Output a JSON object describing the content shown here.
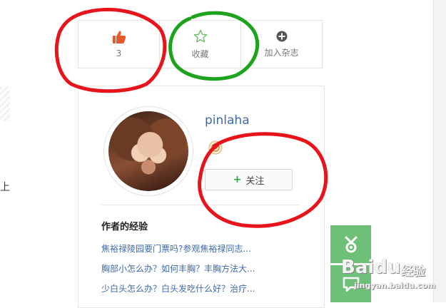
{
  "actions": {
    "like_count": "3",
    "favorite_label": "收藏",
    "magazine_label": "加入杂志"
  },
  "left_fragment": "上",
  "author": {
    "username": "pinlaha",
    "follow_label": "关注",
    "follow_plus": "+"
  },
  "experience": {
    "title": "作者的经验",
    "items": [
      "焦裕禄陵园要门票吗?参观焦裕禄同志...",
      "胸部小怎么办？如何丰胸？丰胸方法大...",
      "少白头怎么办？白头发吃什么好？治疗..."
    ]
  },
  "watermark": {
    "brand": "Bai",
    "brand_suffix": "du",
    "brand_cn": "经验",
    "url": "jingyan.baidu.com"
  },
  "colors": {
    "like": "#e8582a",
    "favorite": "#6dbf6a",
    "link": "#3e6aa8",
    "annotation_red": "#e8141c",
    "annotation_green": "#1ea31e",
    "float_green": "#6ec078"
  },
  "icons": {
    "like": "thumbs-up-icon",
    "favorite": "star-icon",
    "magazine": "plus-circle-icon",
    "float": "share-icon"
  }
}
